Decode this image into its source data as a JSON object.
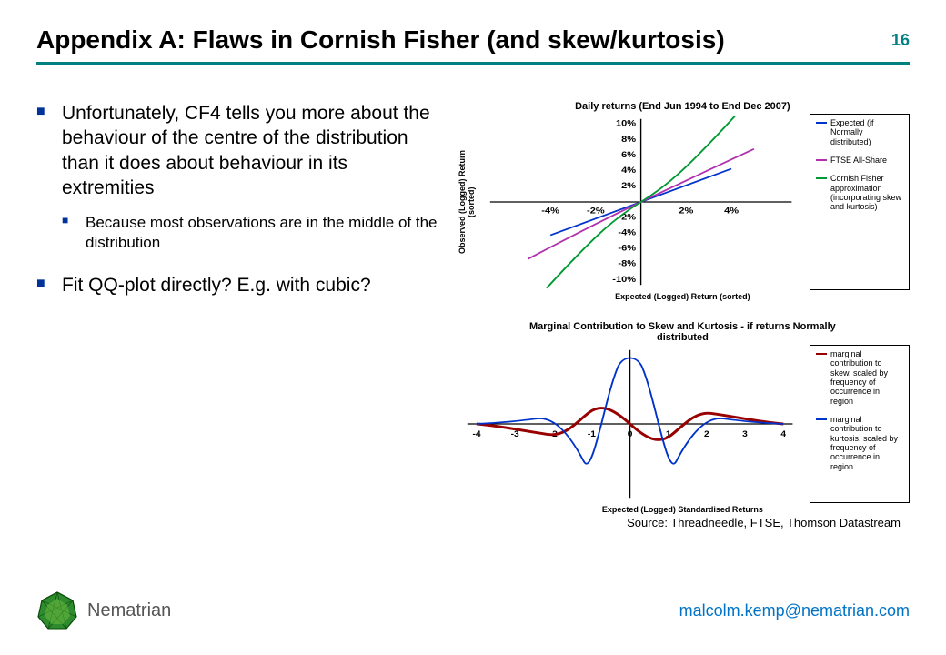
{
  "header": {
    "title": "Appendix A: Flaws in Cornish Fisher (and skew/kurtosis)",
    "page_number": "16"
  },
  "bullets": [
    {
      "text": "Unfortunately, CF4 tells you more about the behaviour of the centre of the distribution than it does about behaviour in its extremities",
      "sub": [
        "Because most observations are in the middle of the distribution"
      ]
    },
    {
      "text": "Fit QQ-plot directly? E.g. with cubic?",
      "sub": []
    }
  ],
  "chart1": {
    "title": "Daily returns (End Jun 1994 to End Dec 2007)",
    "ylabel": "Observed (Logged) Return\n(sorted)",
    "xlabel": "Expected (Logged) Return (sorted)",
    "legend": [
      {
        "label": "Expected (if Normally distributed)",
        "color": "#0033cc"
      },
      {
        "label": "FTSE All-Share",
        "color": "#b030b0"
      },
      {
        "label": "Cornish Fisher approximation (incorporating skew and kurtosis)",
        "color": "#009933"
      }
    ],
    "x_ticks": [
      "-4%",
      "-2%",
      "2%",
      "4%"
    ],
    "y_ticks": [
      "10%",
      "8%",
      "6%",
      "4%",
      "2%",
      "-2%",
      "-4%",
      "-6%",
      "-8%",
      "-10%"
    ]
  },
  "chart2": {
    "title": "Marginal Contribution to Skew and Kurtosis - if returns Normally distributed",
    "xlabel": "Expected (Logged) Standardised Returns",
    "legend": [
      {
        "label": "marginal contribution to skew, scaled by frequency of occurrence in region",
        "color": "#990000"
      },
      {
        "label": "marginal contribution to kurtosis, scaled by frequency of occurrence in region",
        "color": "#0033cc"
      }
    ],
    "x_ticks": [
      "-4",
      "-3",
      "-2",
      "-1",
      "0",
      "1",
      "2",
      "3",
      "4"
    ]
  },
  "source": "Source: Threadneedle, FTSE, Thomson Datastream",
  "footer": {
    "brand": "Nematrian",
    "email": "malcolm.kemp@nematrian.com"
  },
  "chart_data": [
    {
      "type": "line",
      "title": "Daily returns (End Jun 1994 to End Dec 2007)",
      "xlabel": "Expected (Logged) Return (sorted)",
      "ylabel": "Observed (Logged) Return (sorted)",
      "xlim": [
        -5,
        5
      ],
      "ylim": [
        -10,
        10
      ],
      "series": [
        {
          "name": "Expected (if Normally distributed)",
          "color": "#0033cc",
          "x": [
            -4,
            -2,
            0,
            2,
            4
          ],
          "y": [
            -4,
            -2,
            0,
            2,
            4
          ]
        },
        {
          "name": "FTSE All-Share",
          "color": "#b030b0",
          "x": [
            -4,
            -3,
            -2,
            -1,
            0,
            1,
            2,
            3,
            4
          ],
          "y": [
            -6.5,
            -4.0,
            -2.3,
            -1.1,
            0,
            1.0,
            2.2,
            3.6,
            5.8
          ]
        },
        {
          "name": "Cornish Fisher approximation (incorporating skew and kurtosis)",
          "color": "#009933",
          "x": [
            -4,
            -3,
            -2,
            -1,
            0,
            1,
            2,
            3,
            4
          ],
          "y": [
            -10,
            -5.0,
            -2.4,
            -1.0,
            0,
            1.0,
            2.4,
            5.0,
            10
          ]
        }
      ]
    },
    {
      "type": "line",
      "title": "Marginal Contribution to Skew and Kurtosis - if returns Normally distributed",
      "xlabel": "Expected (Logged) Standardised Returns",
      "xlim": [
        -4,
        4
      ],
      "ylim": [
        -1,
        1
      ],
      "series": [
        {
          "name": "marginal contribution to skew",
          "color": "#990000",
          "x": [
            -4,
            -3,
            -2.4,
            -1.8,
            -1.2,
            -0.6,
            0,
            0.6,
            1.2,
            1.8,
            2.4,
            3,
            4
          ],
          "y": [
            0,
            -0.03,
            -0.08,
            -0.15,
            0.05,
            0.22,
            0,
            -0.22,
            -0.05,
            0.15,
            0.08,
            0.03,
            0
          ]
        },
        {
          "name": "marginal contribution to kurtosis",
          "color": "#0033cc",
          "x": [
            -4,
            -3,
            -2.5,
            -2,
            -1.4,
            -0.8,
            -0.3,
            0,
            0.3,
            0.8,
            1.4,
            2,
            2.5,
            3,
            4
          ],
          "y": [
            0,
            0.02,
            0.06,
            0.1,
            -0.2,
            -0.55,
            0.6,
            0.95,
            0.6,
            -0.55,
            -0.2,
            0.1,
            0.06,
            0.02,
            0
          ]
        }
      ]
    }
  ]
}
